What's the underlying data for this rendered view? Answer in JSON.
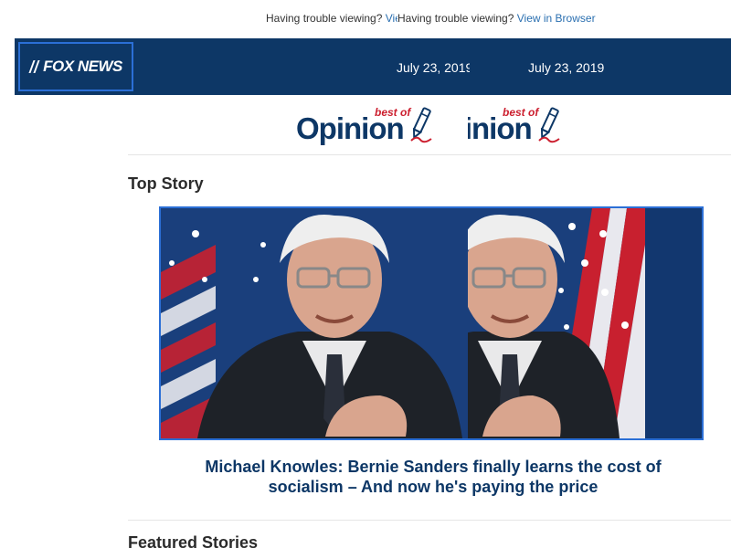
{
  "notice": {
    "text": "Having trouble viewing?",
    "link_label": "View in Browser"
  },
  "header": {
    "logo_text": "FOX NEWS",
    "date": "July 23, 2019"
  },
  "brand": {
    "opinion_word": "Opinion",
    "best_of": "best of"
  },
  "sections": {
    "top_story": "Top Story",
    "featured": "Featured Stories"
  },
  "top_story": {
    "headline_line1": "Michael Knowles: Bernie Sanders finally learns the cost of",
    "headline_line2": "socialism – And now he's paying the price"
  },
  "colors": {
    "header_bg": "#0d3766",
    "link": "#2a6fb0",
    "accent_red": "#cc1f2f",
    "focus_border": "#2b6fd6"
  }
}
